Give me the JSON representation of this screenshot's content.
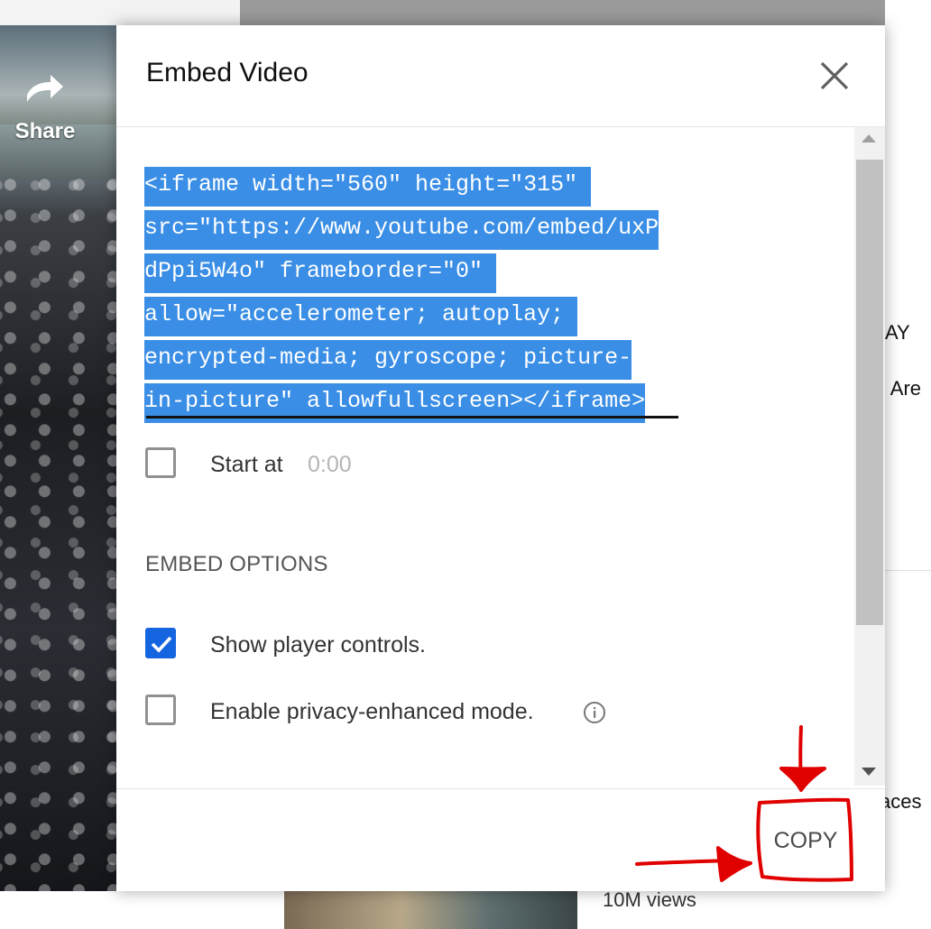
{
  "background": {
    "share_label": "Share",
    "views": "10M views",
    "right_fragments": [
      "AY",
      "l Are",
      "aces"
    ]
  },
  "dialog": {
    "title": "Embed Video",
    "embed_code_lines": [
      "<iframe width=\"560\" height=\"315\" ",
      "src=\"https://www.youtube.com/embed/uxP",
      "dPpi5W4o\" frameborder=\"0\" ",
      "allow=\"accelerometer; autoplay; ",
      "encrypted-media; gyroscope; picture-",
      "in-picture\" allowfullscreen></iframe>"
    ],
    "start_at_label": "Start at",
    "start_at_value": "0:00",
    "start_at_checked": false,
    "embed_options_title": "EMBED OPTIONS",
    "show_controls_label": "Show player controls.",
    "show_controls_checked": true,
    "privacy_label": "Enable privacy-enhanced mode.",
    "privacy_checked": false,
    "copy_label": "COPY"
  },
  "icons": {
    "close": "close-icon",
    "share": "share-icon",
    "info": "info-icon",
    "check": "check-icon"
  },
  "colors": {
    "selection": "#3a8ee6",
    "checkbox_checked": "#1565e0",
    "annotation": "#e00000"
  }
}
